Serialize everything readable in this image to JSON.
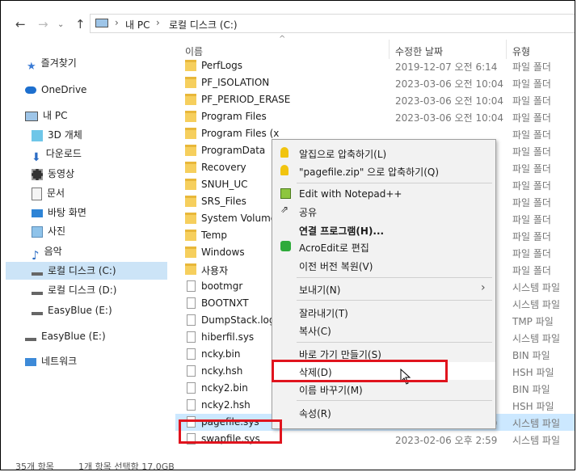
{
  "address": {
    "crumbs": [
      "내 PC",
      "로컬 디스크 (C:)"
    ]
  },
  "nav": {
    "items": [
      {
        "label": "즐겨찾기",
        "icon": "star-icon"
      },
      {
        "label": "OneDrive",
        "icon": "cloud-icon"
      },
      {
        "label": "내 PC",
        "icon": "computer-icon"
      },
      {
        "label": "3D 개체",
        "icon": "cube-icon"
      },
      {
        "label": "다운로드",
        "icon": "download-icon"
      },
      {
        "label": "동영상",
        "icon": "video-icon"
      },
      {
        "label": "문서",
        "icon": "document-icon"
      },
      {
        "label": "바탕 화면",
        "icon": "desktop-icon"
      },
      {
        "label": "사진",
        "icon": "picture-icon"
      },
      {
        "label": "음악",
        "icon": "music-icon"
      },
      {
        "label": "로컬 디스크 (C:)",
        "icon": "drive-icon"
      },
      {
        "label": "로컬 디스크 (D:)",
        "icon": "drive-icon"
      },
      {
        "label": "EasyBlue (E:)",
        "icon": "drive-icon"
      },
      {
        "label": "EasyBlue (E:)",
        "icon": "usb-drive-icon"
      },
      {
        "label": "네트워크",
        "icon": "network-icon"
      }
    ]
  },
  "columns": {
    "name": "이름",
    "date": "수정한 날짜",
    "type": "유형"
  },
  "files": [
    {
      "name": "PerfLogs",
      "date": "2019-12-07 오전 6:14",
      "type": "파일 폴더",
      "kind": "folder"
    },
    {
      "name": "PF_ISOLATION",
      "date": "2023-03-06 오전 10:04",
      "type": "파일 폴더",
      "kind": "folder"
    },
    {
      "name": "PF_PERIOD_ERASE",
      "date": "2023-03-06 오전 10:04",
      "type": "파일 폴더",
      "kind": "folder"
    },
    {
      "name": "Program Files",
      "date": "2023-03-06 오전 10:04",
      "type": "파일 폴더",
      "kind": "folder"
    },
    {
      "name": "Program Files (x",
      "date": "",
      "type": "파일 폴더",
      "kind": "folder"
    },
    {
      "name": "ProgramData",
      "date": "",
      "type": "파일 폴더",
      "kind": "folder"
    },
    {
      "name": "Recovery",
      "date": "",
      "type": "파일 폴더",
      "kind": "folder"
    },
    {
      "name": "SNUH_UC",
      "date": "",
      "type": "파일 폴더",
      "kind": "folder"
    },
    {
      "name": "SRS_Files",
      "date": "",
      "type": "파일 폴더",
      "kind": "folder"
    },
    {
      "name": "System Volume",
      "date": "",
      "type": "파일 폴더",
      "kind": "folder"
    },
    {
      "name": "Temp",
      "date": "",
      "type": "파일 폴더",
      "kind": "folder"
    },
    {
      "name": "Windows",
      "date": "",
      "type": "파일 폴더",
      "kind": "folder"
    },
    {
      "name": "사용자",
      "date": "",
      "type": "파일 폴더",
      "kind": "folder"
    },
    {
      "name": "bootmgr",
      "date": "",
      "type": "시스템 파일",
      "kind": "file"
    },
    {
      "name": "BOOTNXT",
      "date": "",
      "type": "시스템 파일",
      "kind": "file"
    },
    {
      "name": "DumpStack.log.",
      "date": "",
      "type": "TMP 파일",
      "kind": "file"
    },
    {
      "name": "hiberfil.sys",
      "date": "",
      "type": "시스템 파일",
      "kind": "file"
    },
    {
      "name": "ncky.bin",
      "date": "",
      "type": "BIN 파일",
      "kind": "file"
    },
    {
      "name": "ncky.hsh",
      "date": "",
      "type": "HSH 파일",
      "kind": "file"
    },
    {
      "name": "ncky2.bin",
      "date": "",
      "type": "BIN 파일",
      "kind": "file"
    },
    {
      "name": "ncky2.hsh",
      "date": "",
      "type": "HSH 파일",
      "kind": "file"
    },
    {
      "name": "pagefile.sys",
      "date": "2023-02-06 오후 2:59",
      "type": "시스템 파일",
      "kind": "file",
      "selected": true
    },
    {
      "name": "swapfile.sys",
      "date": "2023-02-06 오후 2:59",
      "type": "시스템 파일",
      "kind": "file"
    }
  ],
  "context_menu": {
    "items": [
      {
        "label": "알집으로 압축하기(L)",
        "icon": "alzip-icon"
      },
      {
        "label": "\"pagefile.zip\" 으로 압축하기(Q)",
        "icon": "alzip-icon"
      },
      {
        "label": "Edit with Notepad++",
        "icon": "notepadpp-icon"
      },
      {
        "label": "공유",
        "icon": "share-icon"
      },
      {
        "label": "연결 프로그램(H)...",
        "icon": ""
      },
      {
        "label": "AcroEdit로 편집",
        "icon": "acroedit-icon"
      },
      {
        "label": "이전 버전 복원(V)",
        "icon": ""
      },
      {
        "label": "보내기(N)",
        "icon": ""
      },
      {
        "label": "잘라내기(T)",
        "icon": ""
      },
      {
        "label": "복사(C)",
        "icon": ""
      },
      {
        "label": "바로 가기 만들기(S)",
        "icon": ""
      },
      {
        "label": "삭제(D)",
        "icon": ""
      },
      {
        "label": "이름 바꾸기(M)",
        "icon": ""
      },
      {
        "label": "속성(R)",
        "icon": ""
      }
    ]
  },
  "status": {
    "count": "35개 항목",
    "selected": "1개 항목 선택함 17.0GB"
  },
  "colors": {
    "highlight": "#e0141e",
    "selection": "#cce8ff",
    "folder": "#f6cf5d"
  }
}
